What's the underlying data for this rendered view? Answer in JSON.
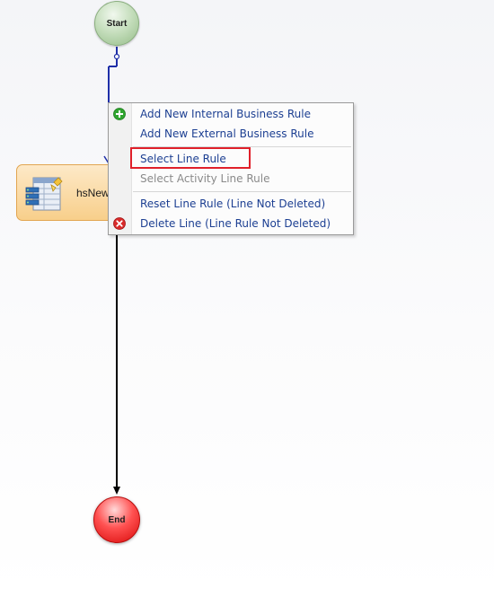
{
  "workflow": {
    "start_label": "Start",
    "end_label": "End",
    "activity_label": "hsNew"
  },
  "context_menu": {
    "items": [
      {
        "label": "Add New Internal Business Rule",
        "icon": "add-icon",
        "enabled": true
      },
      {
        "label": "Add New External Business Rule",
        "icon": "",
        "enabled": true
      },
      {
        "label": "Select Line Rule",
        "icon": "",
        "enabled": true,
        "highlighted": true
      },
      {
        "label": "Select Activity Line Rule",
        "icon": "",
        "enabled": false
      },
      {
        "label": "Reset Line Rule (Line Not Deleted)",
        "icon": "",
        "enabled": true
      },
      {
        "label": "Delete Line (Line Rule Not Deleted)",
        "icon": "delete-icon",
        "enabled": true
      }
    ]
  },
  "colors": {
    "connector_blue": "#1f2fa8",
    "connector_black": "#000000",
    "menu_text": "#1c3f92",
    "highlight": "#e0202a",
    "start_node": "#b5d3aa",
    "end_node": "#ff3b3b",
    "activity_node": "#f8cf8b"
  }
}
